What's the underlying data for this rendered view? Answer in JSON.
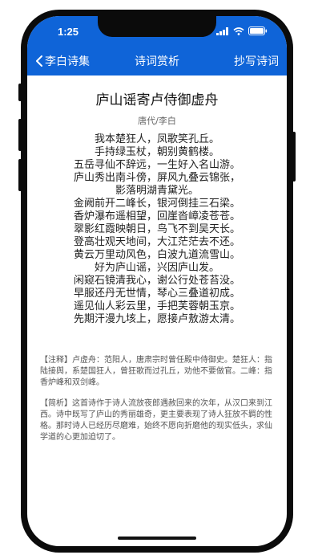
{
  "status": {
    "time": "1:25"
  },
  "nav": {
    "back_label": "李白诗集",
    "title": "诗词赏析",
    "action_label": "抄写诗词"
  },
  "poem": {
    "title": "庐山谣寄卢侍御虚舟",
    "author": "唐代/李白",
    "lines": [
      "我本楚狂人，凤歌笑孔丘。",
      "手持绿玉杖，朝别黄鹤楼。",
      "五岳寻仙不辞远，一生好入名山游。",
      "庐山秀出南斗傍，屏风九叠云锦张，",
      "影落明湖青黛光。",
      "金阙前开二峰长，银河倒挂三石梁。",
      "香炉瀑布遥相望，回崖沓嶂凌苍苍。",
      "翠影红霞映朝日，鸟飞不到吴天长。",
      "登高壮观天地间，大江茫茫去不还。",
      "黄云万里动风色，白波九道流雪山。",
      "好为庐山谣，兴因庐山发。",
      "闲窥石镜清我心，谢公行处苍苔没。",
      "早服还丹无世情，琴心三叠道初成。",
      "遥见仙人彩云里，手把芙蓉朝玉京。",
      "先期汗漫九垓上，愿接卢敖游太清。"
    ],
    "annotation": "【注释】卢虚舟：范阳人，唐肃宗时曾任殿中侍御史。楚狂人：指陆接舆，系楚国狂人，曾狂歌而过孔丘，劝他不要做官。二峰：指香炉峰和双剑峰。",
    "analysis": "【简析】这首诗作于诗人流放夜郎遇赦回来的次年，从汉口来到江西。诗中既写了庐山的秀丽雄奇，更主要表现了诗人狂放不羁的性格。那时诗人已经历尽磨难，始终不愿向折磨他的现实低头，求仙学道的心更加迫切了。"
  },
  "colors": {
    "header": "#0f64d8",
    "frame": "#0b0b0b"
  },
  "icons": {
    "back": "chevron-left-icon",
    "signal": "signal-icon",
    "wifi": "wifi-icon",
    "battery": "battery-icon"
  }
}
